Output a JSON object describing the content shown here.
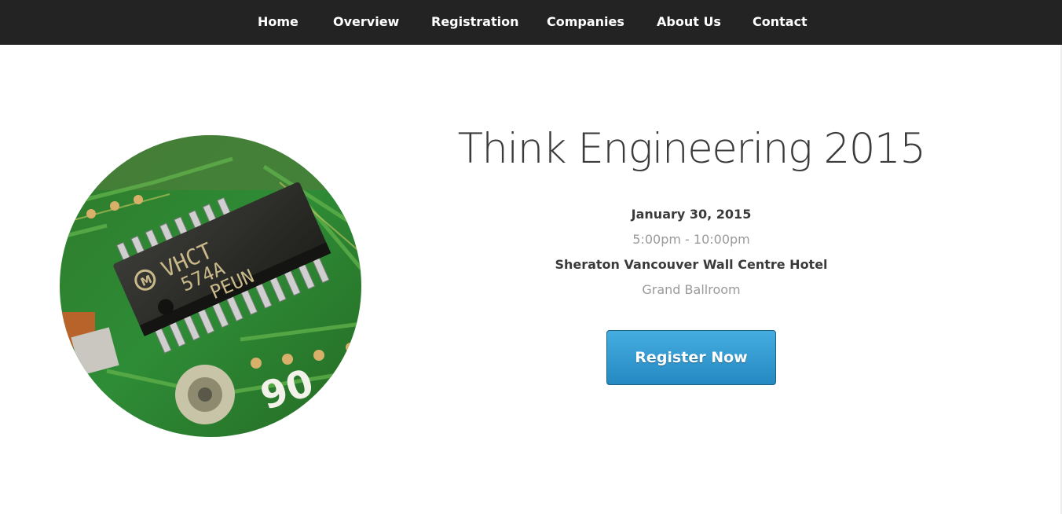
{
  "nav": {
    "items": [
      {
        "label": "Home"
      },
      {
        "label": "Overview"
      },
      {
        "label": "Registration"
      },
      {
        "label": "Companies"
      },
      {
        "label": "About Us"
      },
      {
        "label": "Contact"
      }
    ]
  },
  "hero": {
    "image": {
      "icon": "circuit-chip-photo",
      "chip_text": [
        "VHCT",
        "574A",
        "PEUN"
      ],
      "board_text": "90"
    },
    "title": "Think Engineering 2015",
    "date": "January 30, 2015",
    "time": "5:00pm - 10:00pm",
    "venue": "Sheraton Vancouver Wall Centre Hotel",
    "room": "Grand Ballroom",
    "register_label": "Register Now"
  },
  "colors": {
    "navbar": "#232323",
    "button": "#2f96cf",
    "title": "#3b3b3b"
  }
}
